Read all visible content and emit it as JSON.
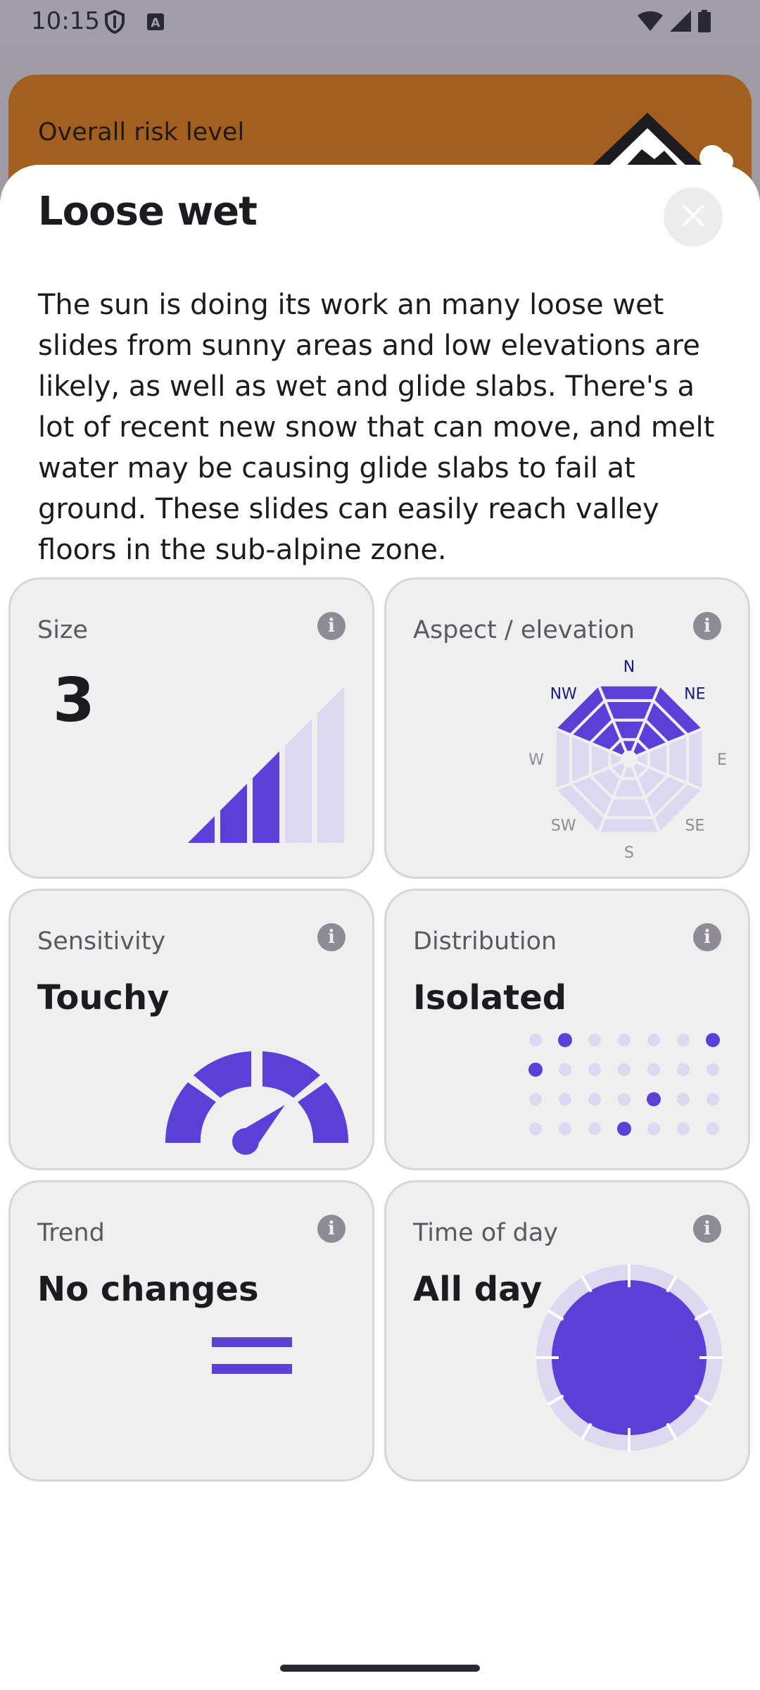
{
  "status_bar": {
    "time": "10:15",
    "icons": [
      "shield-icon",
      "a-badge-icon",
      "wifi-icon",
      "signal-icon",
      "battery-icon"
    ]
  },
  "background_card": {
    "label": "Overall risk level",
    "color": "#a35f20"
  },
  "sheet": {
    "title": "Loose wet",
    "close_icon": "close-icon",
    "description": "The sun is doing its work an many loose wet slides from sunny areas and low elevations are likely, as well as wet and glide slabs. There's a lot of recent new snow that can move, and melt water may be causing glide slabs to fail at ground. These slides can easily reach valley floors in the sub-alpine zone."
  },
  "accent_color": "#5b3fd6",
  "muted_color": "#dcd8f0",
  "tiles": {
    "size": {
      "label": "Size",
      "value": "3",
      "level": 3,
      "max": 5
    },
    "aspect": {
      "label": "Aspect / elevation",
      "directions": [
        "N",
        "NE",
        "E",
        "SE",
        "S",
        "SW",
        "W",
        "NW"
      ],
      "highlighted": [
        "NW",
        "N",
        "NE"
      ]
    },
    "sensitivity": {
      "label": "Sensitivity",
      "value": "Touchy",
      "level": 3,
      "max": 4
    },
    "distribution": {
      "label": "Distribution",
      "value": "Isolated",
      "filled_dots": 5,
      "total_dots": 28
    },
    "trend": {
      "label": "Trend",
      "value": "No changes"
    },
    "time_of_day": {
      "label": "Time of day",
      "value": "All day"
    }
  }
}
